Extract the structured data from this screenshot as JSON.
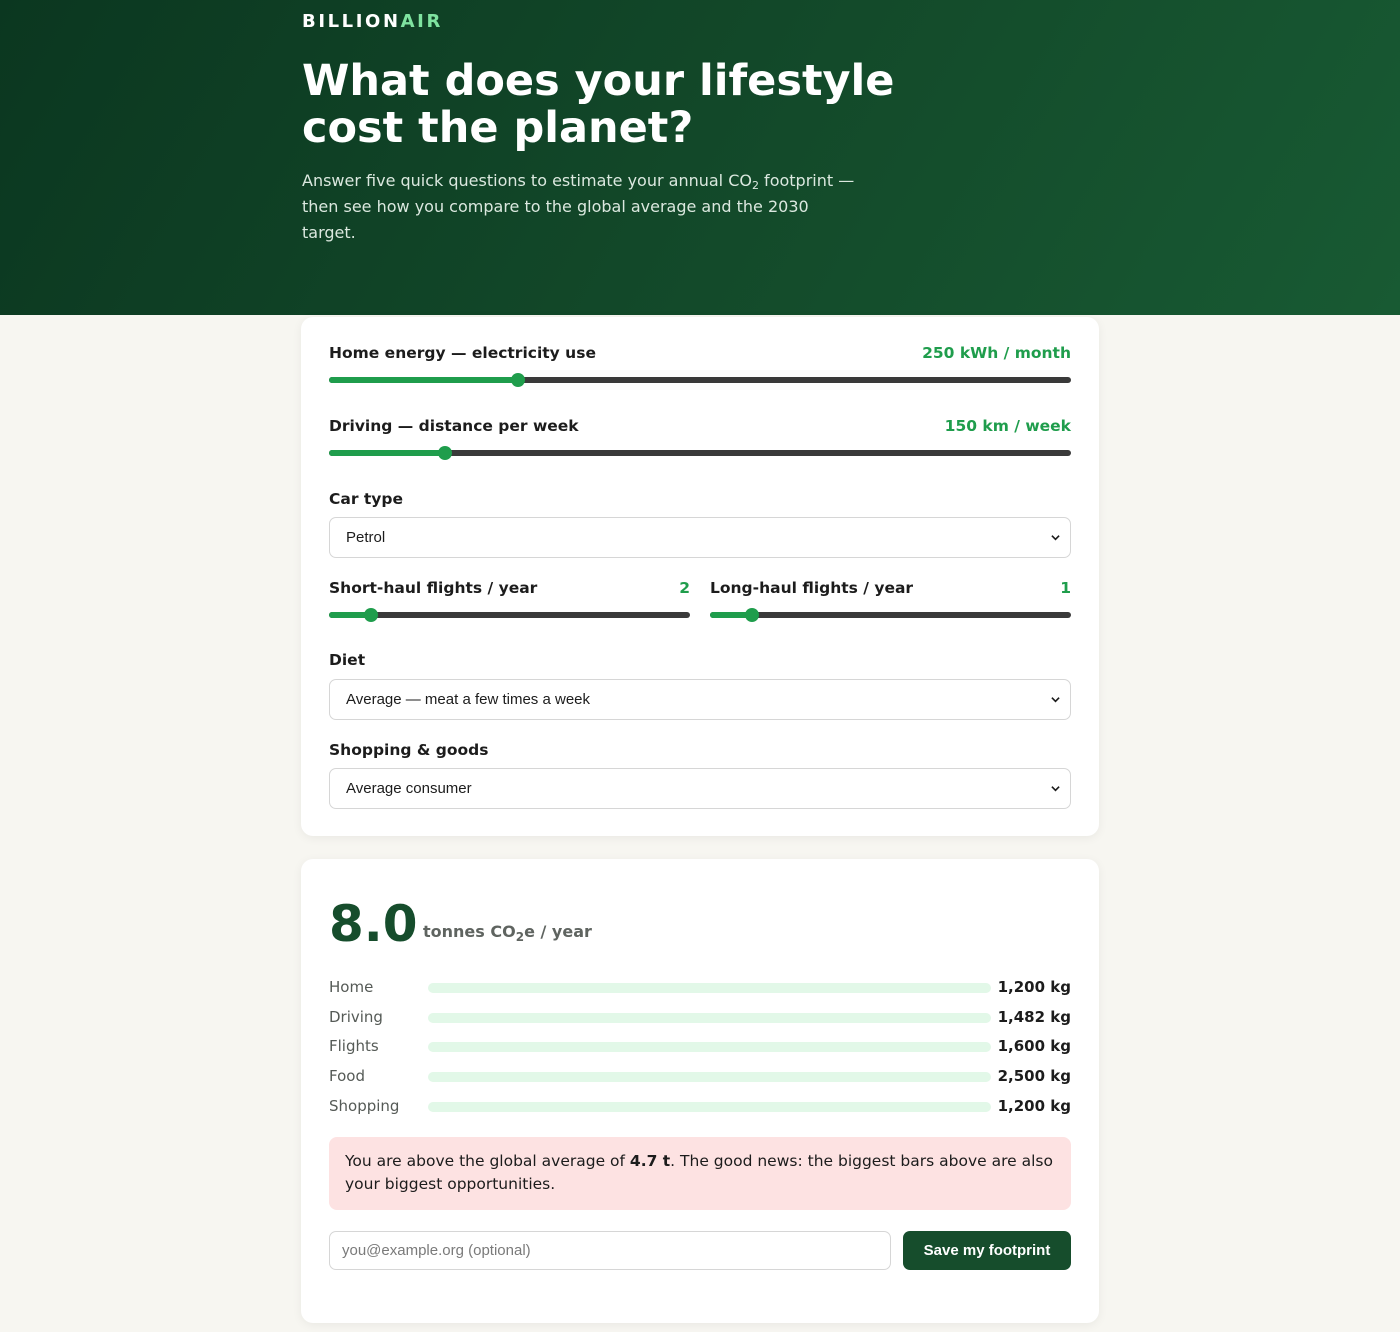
{
  "brand": {
    "part1": "BILLION",
    "part2": "AIR"
  },
  "hero": {
    "title": "What does your lifestyle cost the planet?",
    "subtitle_pre": "Answer five quick questions to estimate your annual CO",
    "subtitle_sub": "2",
    "subtitle_post": " footprint — then see how you compare to the global average and the 2030 target."
  },
  "form": {
    "energy": {
      "label": "Home energy — electricity use",
      "value_text": "250 kWh / month",
      "fraction": 0.255
    },
    "driving": {
      "label": "Driving — distance per week",
      "value_text": "150 km / week",
      "fraction": 0.157
    },
    "car": {
      "label": "Car type",
      "selected": "Petrol"
    },
    "short_haul": {
      "label": "Short-haul flights / year",
      "value_text": "2",
      "fraction": 0.117
    },
    "long_haul": {
      "label": "Long-haul flights / year",
      "value_text": "1",
      "fraction": 0.117
    },
    "diet": {
      "label": "Diet",
      "selected": "Average — meat a few times a week"
    },
    "shopping": {
      "label": "Shopping & goods",
      "selected": "Average consumer"
    }
  },
  "result": {
    "total": "8.0",
    "unit_pre": "tonnes CO",
    "unit_sub": "2",
    "unit_post": "e / year",
    "breakdown": [
      {
        "label": "Home",
        "value": "1,200 kg"
      },
      {
        "label": "Driving",
        "value": "1,482 kg"
      },
      {
        "label": "Flights",
        "value": "1,600 kg"
      },
      {
        "label": "Food",
        "value": "2,500 kg"
      },
      {
        "label": "Shopping",
        "value": "1,200 kg"
      }
    ],
    "notice_pre": "You are above the global average of ",
    "notice_bold": "4.7 t",
    "notice_post": ". The good news: the biggest bars above are also your biggest opportunities.",
    "email_placeholder": "you@example.org (optional)",
    "save_label": "Save my footprint"
  },
  "colors": {
    "accent": "#1f9d4c",
    "dark_green": "#164d2c",
    "notice_bg": "#fde2e2"
  },
  "icons": {
    "select_caret": "chevron-down-icon"
  }
}
